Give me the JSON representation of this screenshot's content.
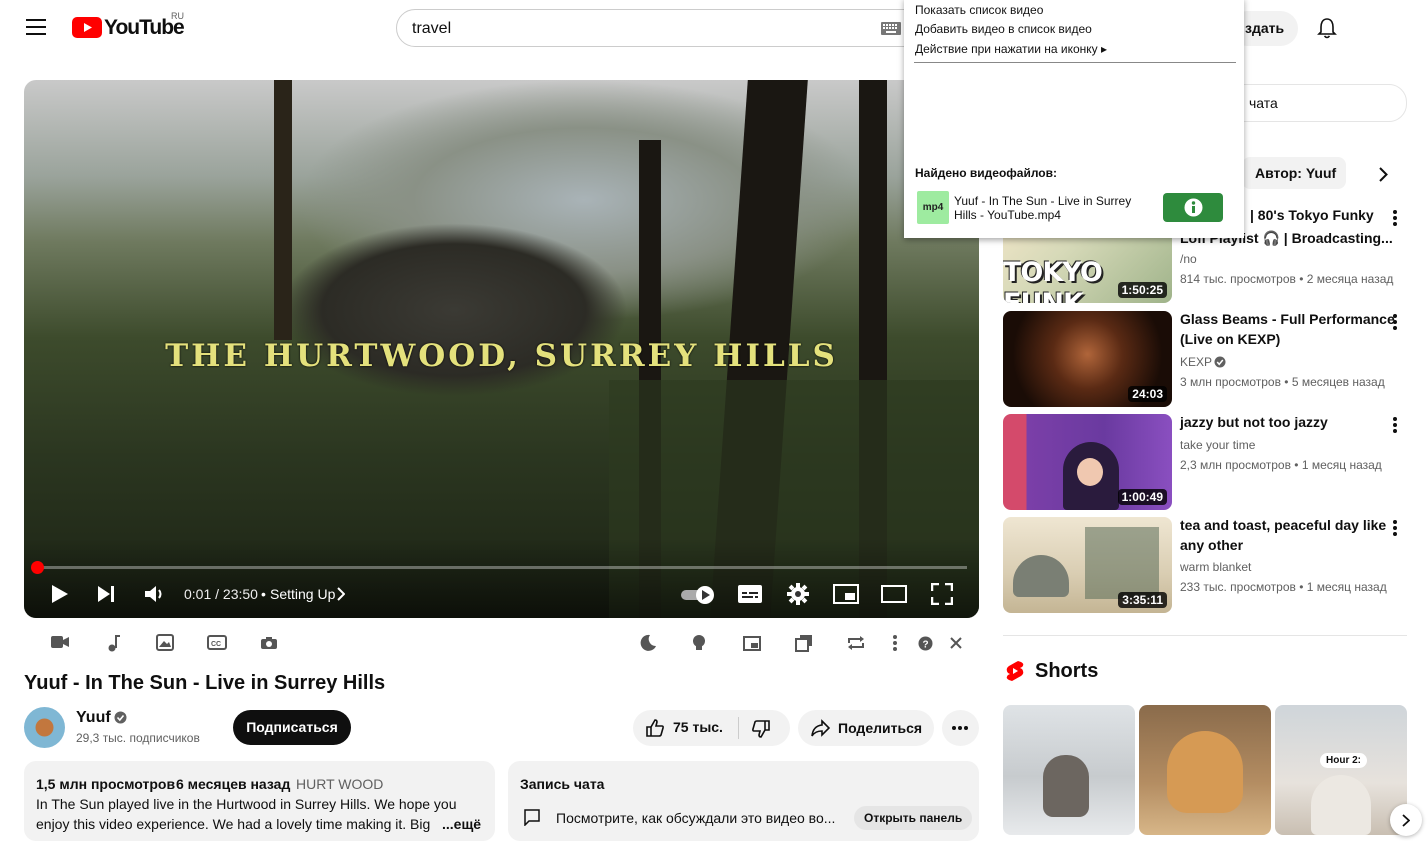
{
  "header": {
    "logo_text": "YouTube",
    "region": "RU",
    "search_value": "travel",
    "create_label_partial": "здать"
  },
  "player": {
    "overlay_title": "THE HURTWOOD, SURREY HILLS",
    "time": "0:01 / 23:50",
    "chapter": "Setting Up",
    "progress_fraction": 0.0007
  },
  "video": {
    "title": "Yuuf - In The Sun - Live in Surrey Hills",
    "channel": "Yuuf",
    "subscribers": "29,3 тыс. подписчиков",
    "subscribe_label": "Подписаться",
    "likes": "75 тыс.",
    "share_label": "Поделиться"
  },
  "description": {
    "views": "1,5 млн просмотров",
    "date": "6 месяцев назад",
    "tag": "HURT WOOD",
    "line1": "In The Sun played live in the Hurtwood in Surrey Hills. We hope you",
    "line2": "enjoy this video experience. We had a lovely time making it. Big",
    "more": "...ещё"
  },
  "chat_replay": {
    "title": "Запись чата",
    "text": "Посмотрите, как обсуждали это видео во...",
    "open_label": "Открыть панель"
  },
  "right_column": {
    "chat_partial": "чата",
    "chip_author": "Автор: Yuuf",
    "videos": [
      {
        "title_line1": "| 80's Tokyo Funky",
        "title_line2": "Lofi Playlist 🎧 | Broadcasting...",
        "channel": "/no",
        "meta": "814 тыс. просмотров • 2 месяца назад",
        "duration": "1:50:25",
        "thumb_text": "TOKYO FUNK"
      },
      {
        "title_line1": "Glass Beams - Full Performance",
        "title_line2": "(Live on KEXP)",
        "channel": "KEXP",
        "meta": "3 млн просмотров • 5 месяцев назад",
        "duration": "24:03"
      },
      {
        "title_line1": "jazzy but not too jazzy",
        "title_line2": "",
        "channel": "take your time",
        "meta": "2,3 млн просмотров • 1 месяц назад",
        "duration": "1:00:49"
      },
      {
        "title_line1": "tea and toast, peaceful day like",
        "title_line2": "any other",
        "channel": "warm blanket",
        "meta": "233 тыс. просмотров • 1 месяц назад",
        "duration": "3:35:11"
      }
    ],
    "shorts_title": "Shorts",
    "short_caption": "Hour 2:"
  },
  "popup": {
    "item1": "Показать список видео",
    "item2": "Добавить видео в список видео",
    "item3": "Действие при нажатии на иконку ▸",
    "found_label": "Найдено видеофайлов:",
    "file_badge": "mp4",
    "file_name": "Yuuf - In The Sun - Live in Surrey Hills - YouTube.mp4"
  },
  "colors": {
    "brand_red": "#ff0000",
    "overlay_title_yellow": "#e4e17c",
    "info_green": "#2e8b3d",
    "mp4_badge": "#9eeba0"
  }
}
